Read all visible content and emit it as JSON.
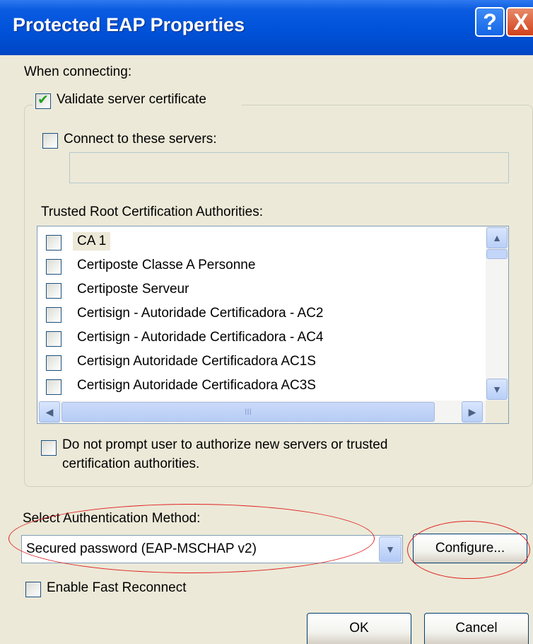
{
  "window": {
    "title": "Protected EAP Properties",
    "help_glyph": "?",
    "close_glyph": "X"
  },
  "when_connecting": "When connecting:",
  "validate_cert": {
    "label": "Validate server certificate",
    "checked": true
  },
  "connect_servers": {
    "label": "Connect to these servers:",
    "checked": false,
    "value": ""
  },
  "trusted_label": "Trusted Root Certification Authorities:",
  "ca_list": [
    {
      "label": "CA 1",
      "checked": false
    },
    {
      "label": "Certiposte Classe A Personne",
      "checked": false
    },
    {
      "label": "Certiposte Serveur",
      "checked": false
    },
    {
      "label": "Certisign - Autoridade Certificadora - AC2",
      "checked": false
    },
    {
      "label": "Certisign - Autoridade Certificadora - AC4",
      "checked": false
    },
    {
      "label": "Certisign Autoridade Certificadora AC1S",
      "checked": false
    },
    {
      "label": "Certisign Autoridade Certificadora AC3S",
      "checked": false
    }
  ],
  "scroll_glyphs": {
    "up": "▲",
    "down": "▼",
    "left": "◀",
    "right": "▶",
    "grip": "III"
  },
  "do_not_prompt": {
    "line1": "Do not prompt user to authorize new servers or trusted",
    "line2": "certification authorities.",
    "checked": false
  },
  "auth_method_label": "Select Authentication Method:",
  "auth_method_value": "Secured password (EAP-MSCHAP v2)",
  "configure_label": "Configure...",
  "fast_reconnect": {
    "label": "Enable Fast Reconnect",
    "checked": false
  },
  "ok_label": "OK",
  "cancel_label": "Cancel",
  "annotation_color": "#E02020"
}
